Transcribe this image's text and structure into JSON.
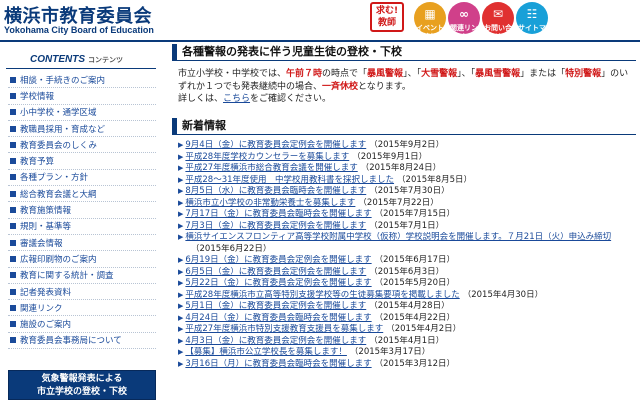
{
  "header": {
    "title": "横浜市教育委員会",
    "subtitle": "Yokohama City Board of Education",
    "badge": "求む!教師",
    "buttons": [
      {
        "label": "イベント情報",
        "color": "#e8a020",
        "icon": "calendar-icon"
      },
      {
        "label": "関連リンク",
        "color": "#d0408a",
        "icon": "link-icon"
      },
      {
        "label": "お問い合せ",
        "color": "#e03030",
        "icon": "mail-icon"
      },
      {
        "label": "サイトマップ",
        "color": "#18a0d8",
        "icon": "sitemap-icon"
      }
    ]
  },
  "sidebar": {
    "heading": "CONTENTS",
    "heading_sub": "コンテンツ",
    "items": [
      {
        "label": "相談・手続きのご案内"
      },
      {
        "label": "学校情報"
      },
      {
        "label": "小中学校・通学区域"
      },
      {
        "label": "教職員採用・育成など"
      },
      {
        "label": "教育委員会のしくみ"
      },
      {
        "label": "教育予算"
      },
      {
        "label": "各種プラン・方針"
      },
      {
        "label": "総合教育会議と大綱"
      },
      {
        "label": "教育施策情報"
      },
      {
        "label": "規則・基準等"
      },
      {
        "label": "審議会情報"
      },
      {
        "label": "広報印刷物のご案内"
      },
      {
        "label": "教育に関する統計・調査"
      },
      {
        "label": "記者発表資料"
      },
      {
        "label": "関連リンク"
      },
      {
        "label": "施設のご案内"
      },
      {
        "label": "教育委員会事務局について"
      }
    ],
    "banner_line1": "気象警報発表による",
    "banner_line2": "市立学校の登校・下校"
  },
  "notice": {
    "title": "各種警報の発表に伴う児童生徒の登校・下校",
    "p1": "市立小学校・中学校では、",
    "p2": "午前７時",
    "p3": "の時点で「",
    "p4": "暴風警報",
    "p5": "」、「",
    "p6": "大雪警報",
    "p7": "」、「",
    "p8": "暴風雪警報",
    "p9": "」または「",
    "p10": "特別警報",
    "p11": "」のいずれか１つでも発表継続中の場合、",
    "p12": "一斉休校",
    "p13": "となります。",
    "p14": "詳しくは、",
    "link": "こちら",
    "p15": "をご確認ください。"
  },
  "news": {
    "title": "新着情報",
    "items": [
      {
        "text": "9月4日（金）に教育委員会定例会を開催します",
        "date": "（2015年9月2日）"
      },
      {
        "text": "平成28年度学校カウンセラーを募集します",
        "date": "（2015年9月1日）"
      },
      {
        "text": "平成27年度横浜市総合教育会議を開催します",
        "date": "（2015年8月24日）"
      },
      {
        "text": "平成28～31年度使用　中学校用教科書を採択しました",
        "date": "（2015年8月5日）"
      },
      {
        "text": "8月5日（水）に教育委員会臨時会を開催します",
        "date": "（2015年7月30日）"
      },
      {
        "text": "横浜市立小学校の非常勤栄養士を募集します",
        "date": "（2015年7月22日）"
      },
      {
        "text": "7月17日（金）に教育委員会臨時会を開催します",
        "date": "（2015年7月15日）"
      },
      {
        "text": "7月3日（金）に教育委員会定例会を開催します",
        "date": "（2015年7月1日）"
      },
      {
        "text": "横浜サイエンスフロンティア高等学校附属中学校（仮称）学校説明会を開催します。７月21日（火）申込み締切",
        "date": ""
      },
      {
        "text": "",
        "date": "（2015年6月22日）"
      },
      {
        "text": "6月19日（金）に教育委員会定例会を開催します",
        "date": "（2015年6月17日）"
      },
      {
        "text": "6月5日（金）に教育委員会定例会を開催します",
        "date": "（2015年6月3日）"
      },
      {
        "text": "5月22日（金）に教育委員会定例会を開催します",
        "date": "（2015年5月20日）"
      },
      {
        "text": "平成28年度横浜市立高等特別支援学校等の生徒募集要項を掲載しました",
        "date": "（2015年4月30日）"
      },
      {
        "text": "5月1日（金）に教育委員会定例会を開催します",
        "date": "（2015年4月28日）"
      },
      {
        "text": "4月24日（金）に教育委員会臨時会を開催します",
        "date": "（2015年4月22日）"
      },
      {
        "text": "平成27年度横浜市特別支援教育支援員を募集します",
        "date": "（2015年4月2日）"
      },
      {
        "text": "4月3日（金）に教育委員会定例会を開催します",
        "date": "（2015年4月1日）"
      },
      {
        "text": "【募集】横浜市公立学校長を募集します！",
        "date": "（2015年3月17日）"
      },
      {
        "text": "3月16日（月）に教育委員会臨時会を開催します",
        "date": "（2015年3月12日）"
      }
    ]
  },
  "colors": {
    "navy": "#0a3a7a",
    "link": "#1a4a9a",
    "alert": "#d01818"
  }
}
